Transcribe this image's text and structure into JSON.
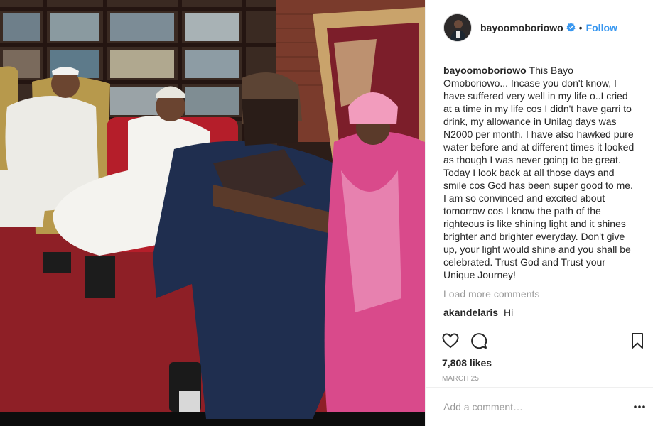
{
  "post": {
    "username": "bayoomoboriowo",
    "follow_label": "Follow",
    "separator": "•",
    "caption": "This Bayo Omoboriowo... Incase you don't know, I have suffered very well in my life o..I cried at a time in my life cos I didn't have garri to drink, my allowance in Unilag days was N2000 per month. I have also hawked pure water before and at different times it looked as though I was never going to be great. Today I look back at all those days and smile cos God has been super good to me. I am so convinced and excited about tomorrow cos I know the path of the righteous is like shining light and it shines brighter and brighter everyday. Don't give up, your light would shine and you shall be celebrated. Trust God and Trust your Unique Journey!",
    "load_more_label": "Load more comments",
    "comments": [
      {
        "username": "akandelaris",
        "text": "Hi"
      }
    ],
    "likes": "7,808 likes",
    "date": "MARCH 25",
    "comment_placeholder": "Add a comment…"
  },
  "icons": {
    "verified": "verified-badge-icon",
    "like": "heart-icon",
    "comment": "comment-icon",
    "save": "bookmark-icon",
    "more": "more-options-icon"
  },
  "colors": {
    "link_blue": "#3897f0",
    "verified_blue": "#3897f0",
    "muted": "#999999",
    "text": "#262626",
    "divider": "#efefef"
  }
}
